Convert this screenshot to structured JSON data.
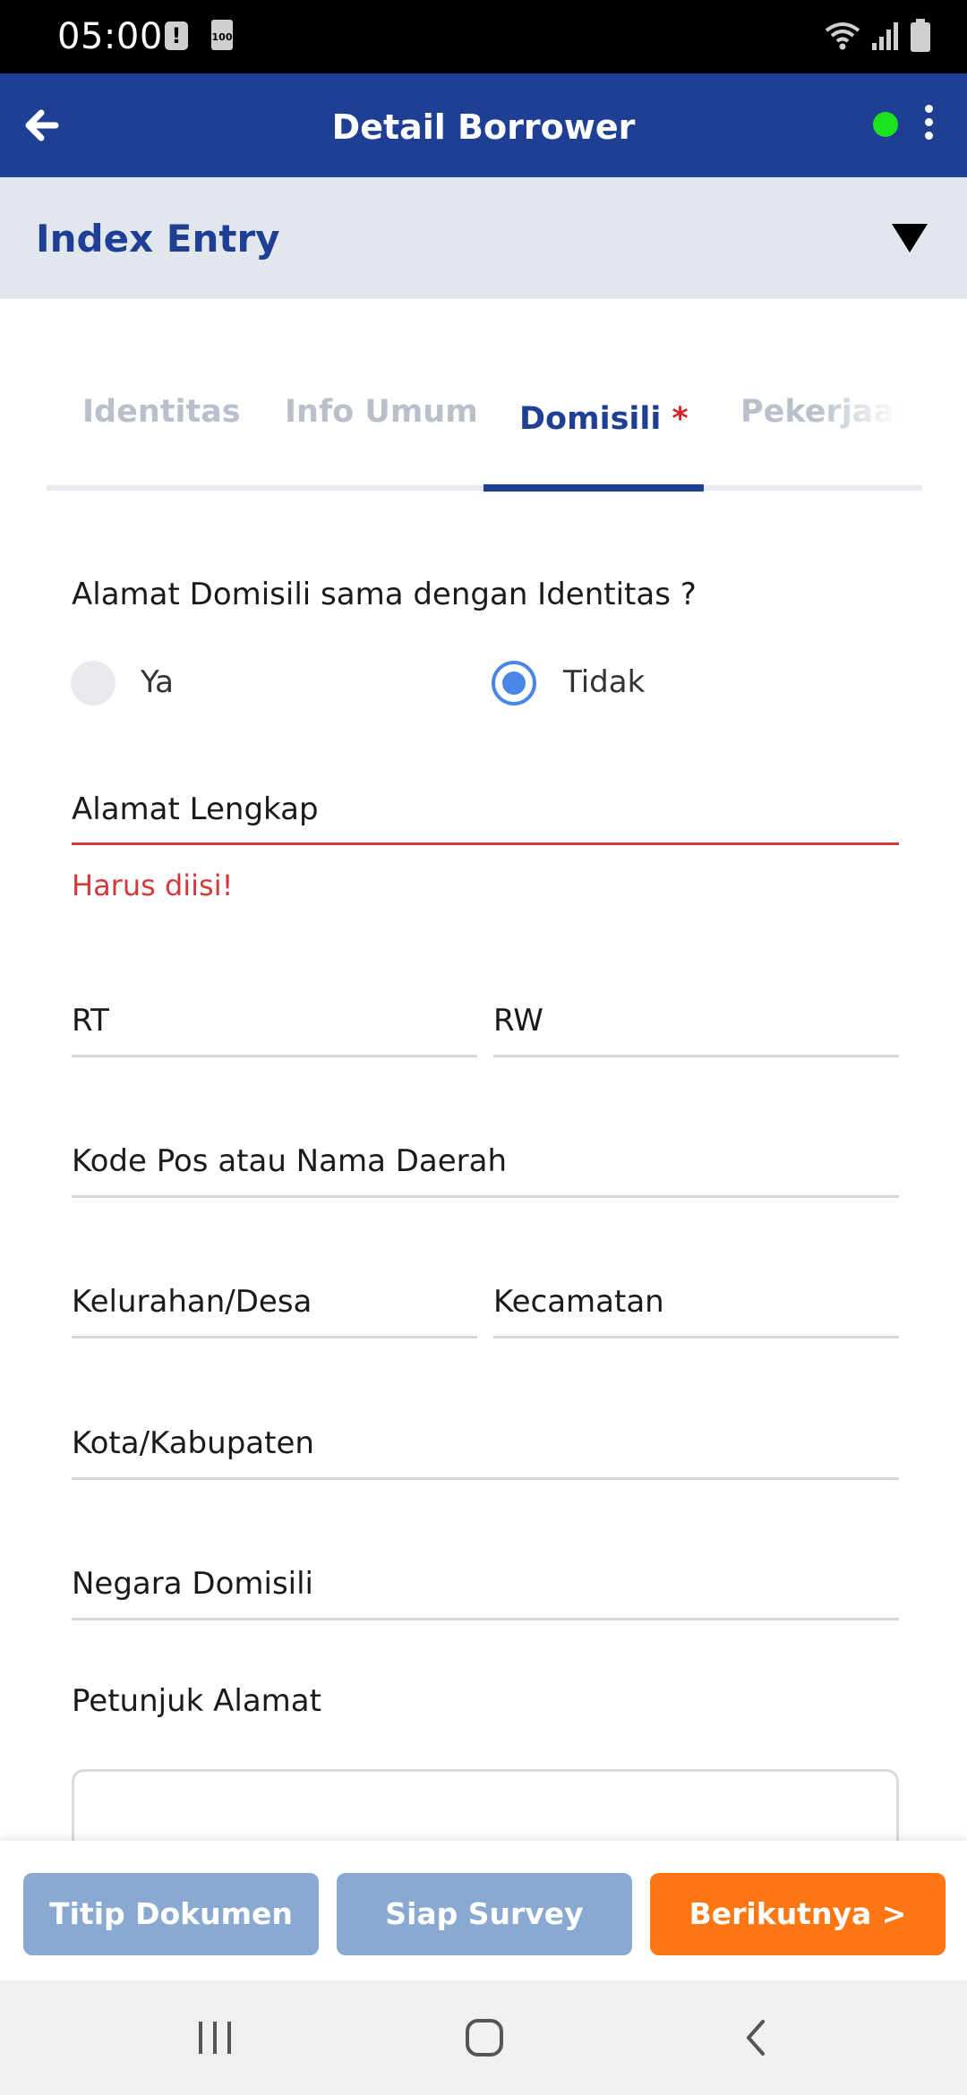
{
  "status_bar": {
    "time": "05:00",
    "alert_icon": "exclamation-icon",
    "battery_small_label": "100",
    "icons": [
      "wifi-icon",
      "signal-icon",
      "battery-icon"
    ]
  },
  "app_bar": {
    "title": "Detail Borrower",
    "status_dot_color": "#1be322",
    "back_icon": "arrow-left-icon",
    "menu_icon": "more-vertical-icon"
  },
  "index_entry": {
    "label": "Index Entry",
    "icon": "caret-down-icon"
  },
  "tabs": [
    {
      "label": "Identitas"
    },
    {
      "label": "Info Umum"
    },
    {
      "label": "Domisili",
      "required_mark": "*",
      "active": true
    },
    {
      "label": "Pekerjaan"
    }
  ],
  "form": {
    "question": "Alamat Domisili sama dengan Identitas ?",
    "radio_options": [
      {
        "label": "Ya",
        "selected": false
      },
      {
        "label": "Tidak",
        "selected": true
      }
    ],
    "alamat_lengkap": {
      "label": "Alamat Lengkap",
      "error": "Harus diisi!"
    },
    "rt": {
      "label": "RT"
    },
    "rw": {
      "label": "RW"
    },
    "kode_pos": {
      "label": "Kode Pos atau Nama Daerah"
    },
    "kelurahan": {
      "label": "Kelurahan/Desa"
    },
    "kecamatan": {
      "label": "Kecamatan"
    },
    "kota": {
      "label": "Kota/Kabupaten"
    },
    "negara": {
      "label": "Negara Domisili"
    },
    "petunjuk": {
      "label": "Petunjuk Alamat",
      "value": ""
    }
  },
  "actions": {
    "titip_dokumen": "Titip Dokumen",
    "siap_survey": "Siap Survey",
    "berikutnya": "Berikutnya >"
  },
  "colors": {
    "primary": "#1f3f94",
    "accent": "#ff7614",
    "error": "#d23a3a",
    "disabled_button": "#8aa9d0"
  },
  "nav_bar": {
    "icons": [
      "recent-apps-icon",
      "home-icon",
      "back-icon"
    ]
  }
}
